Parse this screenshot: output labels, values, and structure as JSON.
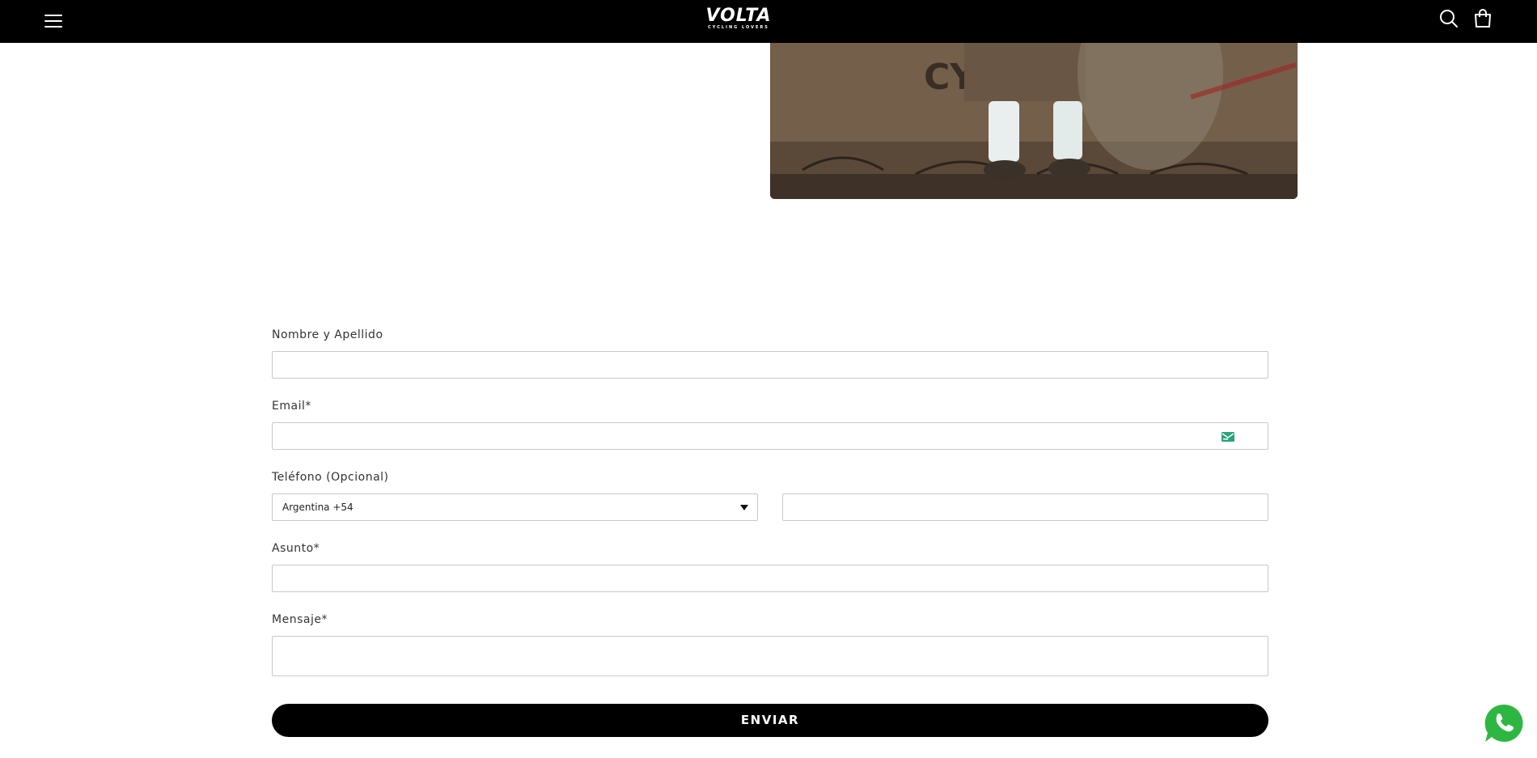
{
  "header": {
    "brand": "VOLTA",
    "tagline": "CYCLING LOVERS"
  },
  "form": {
    "name_label": "Nombre y Apellido",
    "email_label": "Email*",
    "phone_label": "Teléfono (Opcional)",
    "country_select_value": "Argentina +54",
    "subject_label": "Asunto*",
    "message_label": "Mensaje*",
    "submit_label": "ENVIAR"
  },
  "hero": {
    "box_text": "CY  L"
  },
  "icons": {
    "menu": "hamburger-menu-icon",
    "search": "search-icon",
    "cart": "shopping-bag-icon",
    "email_field": "mail-icon",
    "whatsapp": "whatsapp-icon"
  },
  "colors": {
    "header_bg": "#000000",
    "button_bg": "#000000",
    "whatsapp_green": "#2db742",
    "mail_badge": "#29a37c"
  }
}
